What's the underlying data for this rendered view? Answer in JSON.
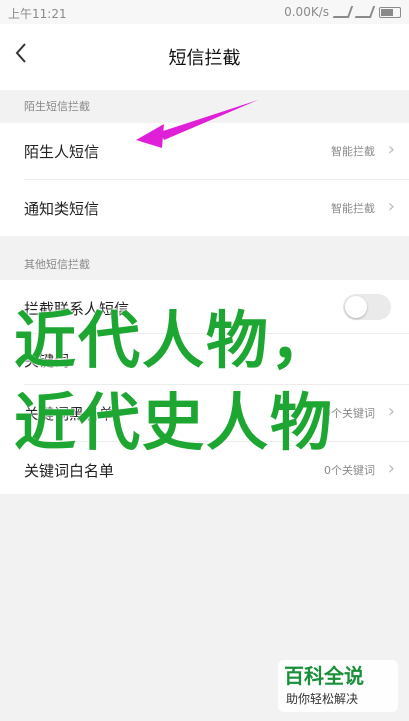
{
  "status": {
    "time": "上午11:21",
    "speed": "0.00K/s"
  },
  "header": {
    "back_icon": "chevron-left-icon",
    "title": "短信拦截"
  },
  "sections": {
    "stranger": {
      "header": "陌生短信拦截",
      "items": [
        {
          "label": "陌生人短信",
          "value": "智能拦截"
        },
        {
          "label": "通知类短信",
          "value": "智能拦截"
        }
      ]
    },
    "other": {
      "header": "其他短信拦截",
      "items": [
        {
          "label": "拦截联系人短信",
          "toggle": false
        },
        {
          "label": "关键词",
          "value": ""
        },
        {
          "label": "关键词黑名单",
          "value": "0个关键词"
        },
        {
          "label": "关键词白名单",
          "value": "0个关键词"
        }
      ]
    }
  },
  "overlay": {
    "line1": "近代人物，",
    "line2": "近代史人物",
    "color": "#1ea632"
  },
  "annotation": {
    "arrow_color": "#e020d8"
  },
  "watermark": {
    "name": "百科全说",
    "tagline": "助你轻松解决"
  }
}
